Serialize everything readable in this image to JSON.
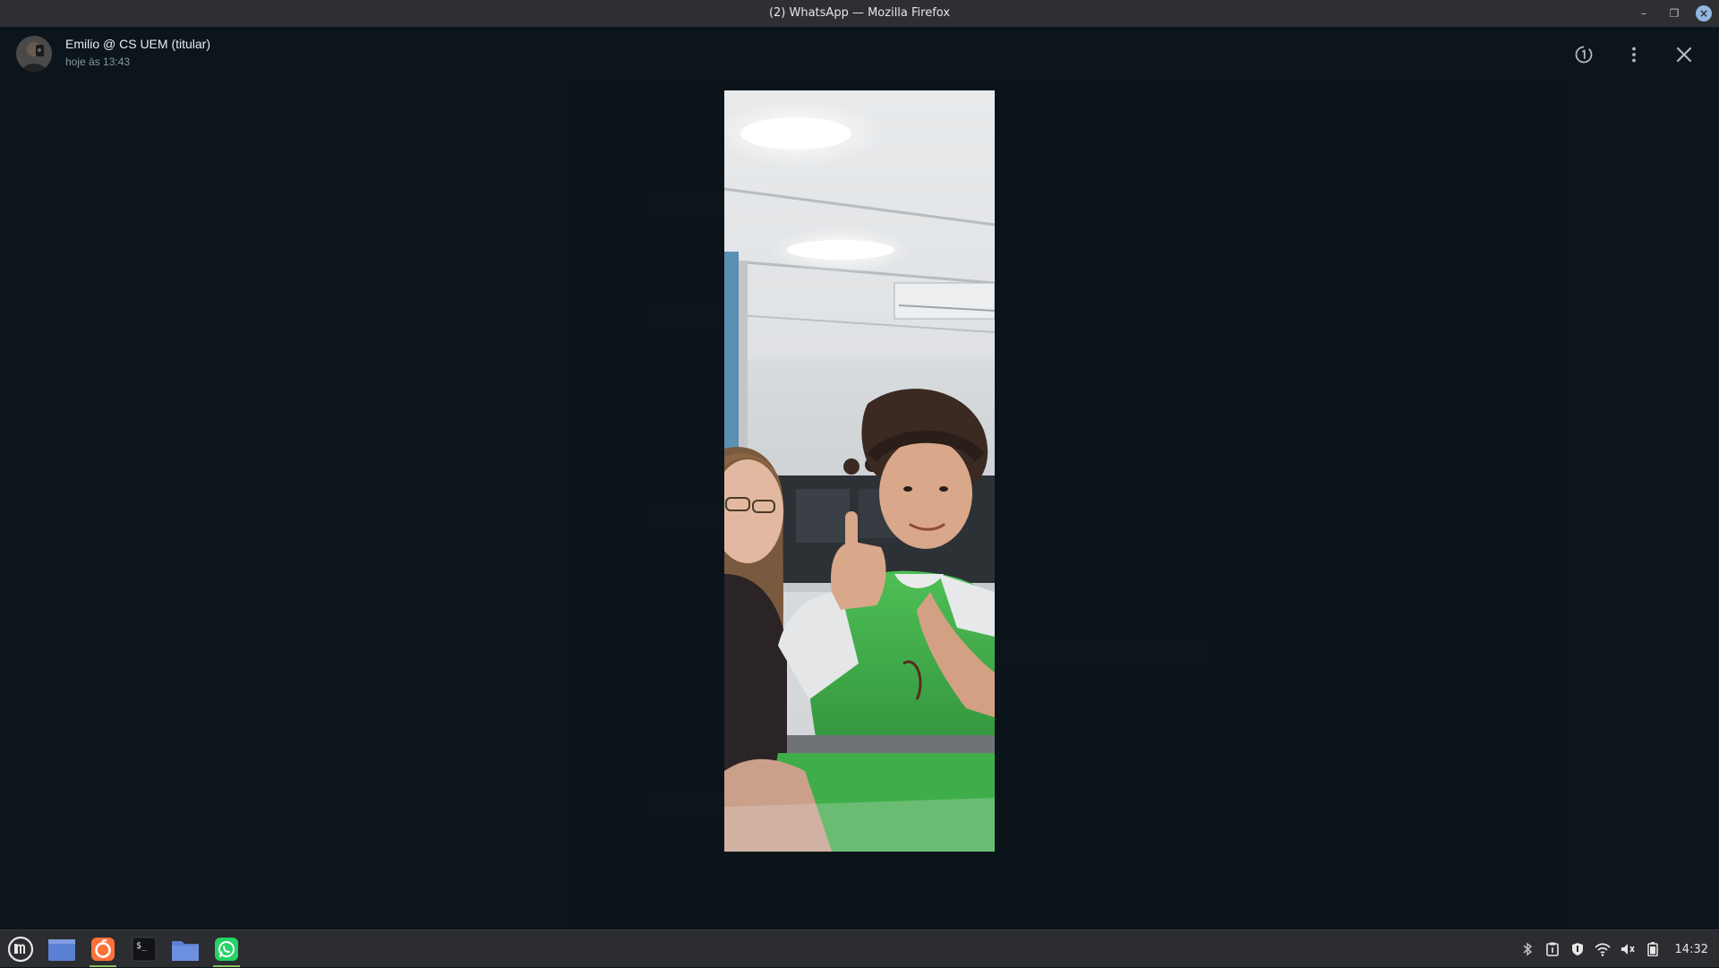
{
  "window": {
    "title": "(2) WhatsApp — Mozilla Firefox",
    "minimize_label": "–",
    "maximize_label": "❐",
    "close_label": "×"
  },
  "viewer": {
    "sender_name": "Emilio @ CS UEM (titular)",
    "sent_time": "hoje às 13:43",
    "actions": [
      "view-once-icon",
      "menu-icon",
      "close-icon"
    ]
  },
  "photo": {
    "description_icon": "photo"
  },
  "taskbar": {
    "apps": [
      "mint-menu-icon",
      "files-icon",
      "firefox-icon",
      "terminal-icon",
      "folder-icon",
      "whatsapp-icon"
    ],
    "tray": [
      "bluetooth-icon",
      "clipboard-icon",
      "shield-icon",
      "wifi-icon",
      "volume-icon",
      "battery-icon"
    ],
    "clock": "14:32"
  },
  "colors": {
    "accent": "#00a884",
    "firefox": "#ff7139",
    "whatsapp": "#25d366",
    "shirt_green": "#3fae4a"
  }
}
